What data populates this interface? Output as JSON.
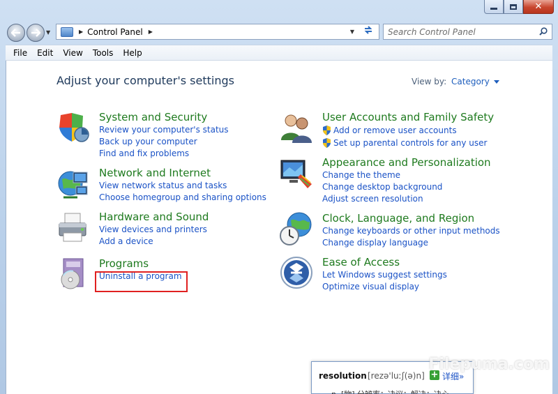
{
  "window": {
    "minimize_icon": "minimize-icon",
    "maximize_icon": "maximize-icon",
    "close_label": "✕"
  },
  "nav": {
    "breadcrumb": [
      "Control Panel"
    ],
    "search_placeholder": "Search Control Panel"
  },
  "menu": [
    "File",
    "Edit",
    "View",
    "Tools",
    "Help"
  ],
  "main": {
    "title": "Adjust your computer's settings",
    "view_by_label": "View by:",
    "view_by_value": "Category",
    "categories": [
      {
        "title": "System and Security",
        "icon": "security-shield-icon",
        "links": [
          "Review your computer's status",
          "Back up your computer",
          "Find and fix problems"
        ]
      },
      {
        "title": "Network and Internet",
        "icon": "network-globe-icon",
        "links": [
          "View network status and tasks",
          "Choose homegroup and sharing options"
        ]
      },
      {
        "title": "Hardware and Sound",
        "icon": "printer-icon",
        "links": [
          "View devices and printers",
          "Add a device"
        ]
      },
      {
        "title": "Programs",
        "icon": "programs-disc-icon",
        "links": [
          "Uninstall a program"
        ]
      },
      {
        "title": "User Accounts and Family Safety",
        "icon": "users-icon",
        "links": [
          "Add or remove user accounts",
          "Set up parental controls for any user"
        ]
      },
      {
        "title": "Appearance and Personalization",
        "icon": "monitor-palette-icon",
        "links": [
          "Change the theme",
          "Change desktop background",
          "Adjust screen resolution"
        ]
      },
      {
        "title": "Clock, Language, and Region",
        "icon": "clock-globe-icon",
        "links": [
          "Change keyboards or other input methods",
          "Change display language"
        ]
      },
      {
        "title": "Ease of Access",
        "icon": "ease-of-access-icon",
        "links": [
          "Let Windows suggest settings",
          "Optimize visual display"
        ]
      }
    ]
  },
  "dictionary": {
    "word": "resolution",
    "phonetic": "[rezə'luːʃ(ə)n]",
    "more": "详细»",
    "definition": "n. [物] 分辨率；决议；解决；决心"
  },
  "watermark": "Filepuma.com",
  "colors": {
    "link": "#1a52c6",
    "category_title": "#1e7a1e",
    "title": "#1e395b",
    "highlight": "#e02020"
  }
}
